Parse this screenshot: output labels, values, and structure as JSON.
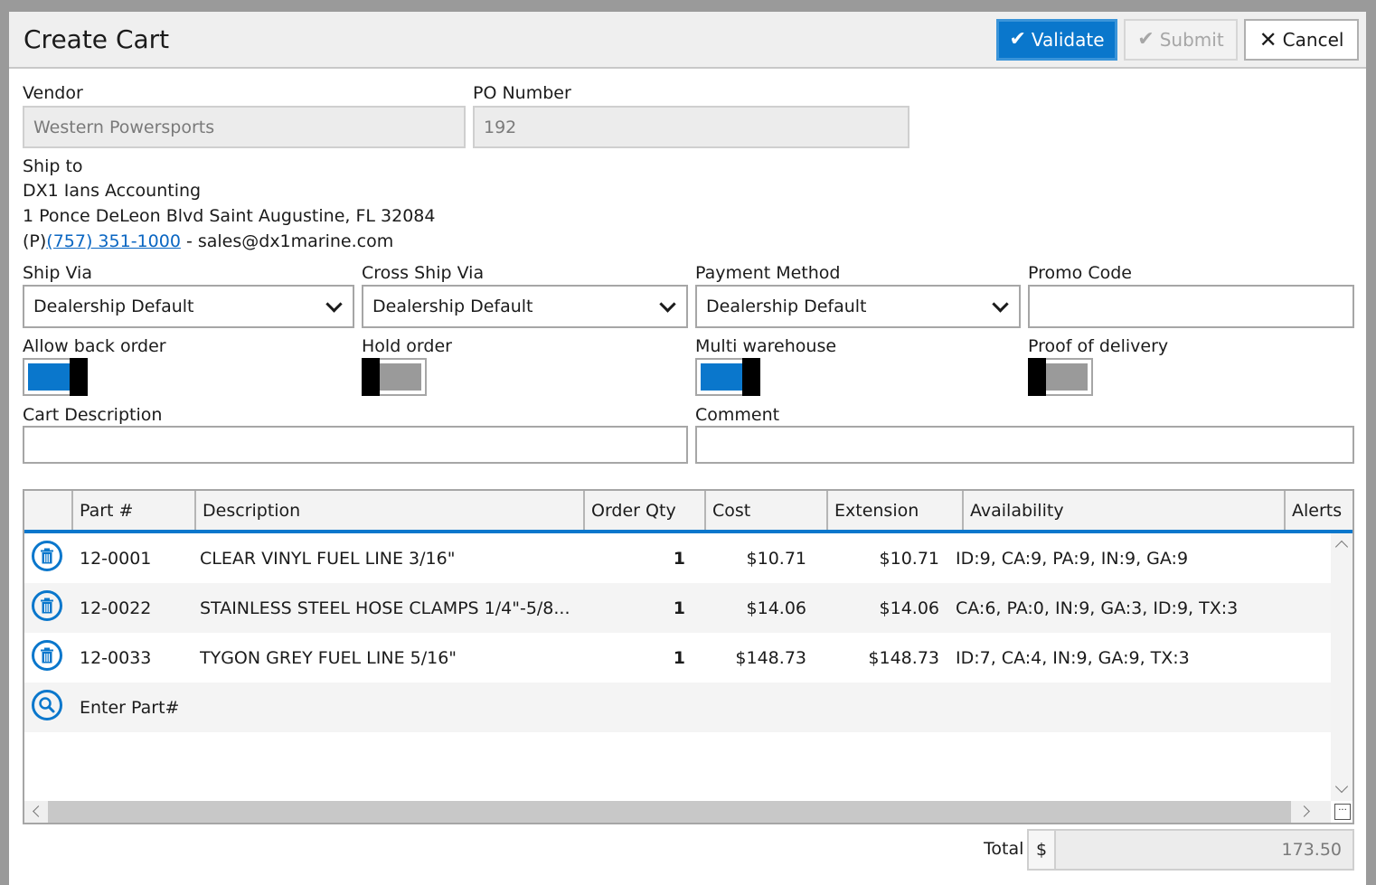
{
  "header": {
    "title": "Create Cart",
    "validate_label": "Validate",
    "submit_label": "Submit",
    "cancel_label": "Cancel"
  },
  "vendor": {
    "label": "Vendor",
    "value": "Western Powersports"
  },
  "po": {
    "label": "PO Number",
    "value": "192"
  },
  "ship_to": {
    "label": "Ship to",
    "name": "DX1 Ians Accounting",
    "address": "1 Ponce DeLeon Blvd Saint Augustine, FL 32084",
    "phone_prefix": "(P)",
    "phone": "(757) 351-1000",
    "email_sep": " - ",
    "email": "sales@dx1marine.com"
  },
  "ship_via": {
    "label": "Ship Via",
    "value": "Dealership Default"
  },
  "cross_ship_via": {
    "label": "Cross Ship Via",
    "value": "Dealership Default"
  },
  "payment_method": {
    "label": "Payment Method",
    "value": "Dealership Default"
  },
  "promo_code": {
    "label": "Promo Code",
    "value": ""
  },
  "toggles": {
    "allow_back_order": {
      "label": "Allow back order",
      "on": true
    },
    "hold_order": {
      "label": "Hold order",
      "on": false
    },
    "multi_warehouse": {
      "label": "Multi warehouse",
      "on": true
    },
    "proof_of_delivery": {
      "label": "Proof of delivery",
      "on": false
    }
  },
  "cart_description": {
    "label": "Cart Description",
    "value": ""
  },
  "comment": {
    "label": "Comment",
    "value": ""
  },
  "grid": {
    "columns": [
      "Part #",
      "Description",
      "Order Qty",
      "Cost",
      "Extension",
      "Availability",
      "Alerts"
    ],
    "rows": [
      {
        "part": "12-0001",
        "description": "CLEAR VINYL FUEL LINE 3/16\"",
        "qty": "1",
        "cost": "$10.71",
        "extension": "$10.71",
        "availability": "ID:9, CA:9, PA:9, IN:9, GA:9"
      },
      {
        "part": "12-0022",
        "description": "STAINLESS STEEL HOSE CLAMPS 1/4\"-5/8...",
        "qty": "1",
        "cost": "$14.06",
        "extension": "$14.06",
        "availability": "CA:6, PA:0, IN:9, GA:3, ID:9, TX:3"
      },
      {
        "part": "12-0033",
        "description": "TYGON GREY FUEL LINE 5/16\"",
        "qty": "1",
        "cost": "$148.73",
        "extension": "$148.73",
        "availability": "ID:7, CA:4, IN:9, GA:9, TX:3"
      }
    ],
    "entry_placeholder": "Enter Part#",
    "corner_glyph": "..."
  },
  "total": {
    "label": "Total",
    "currency": "$",
    "value": "173.50"
  },
  "colors": {
    "accent": "#0a77cc",
    "toggle_off": "#9a9a9a"
  },
  "icons": {
    "row_action": "trash-icon",
    "entry_action": "search-icon"
  }
}
